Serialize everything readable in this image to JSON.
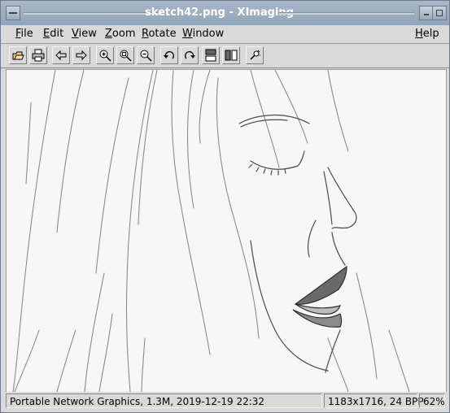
{
  "window": {
    "title": "sketch42.png - XImaging"
  },
  "menubar": {
    "items": [
      {
        "key": "file",
        "label_u": "F",
        "label_rest": "ile"
      },
      {
        "key": "edit",
        "label_u": "E",
        "label_rest": "dit"
      },
      {
        "key": "view",
        "label_u": "V",
        "label_rest": "iew"
      },
      {
        "key": "zoom",
        "label_u": "Z",
        "label_rest": "oom"
      },
      {
        "key": "rotate",
        "label_u": "R",
        "label_rest": "otate"
      },
      {
        "key": "window",
        "label_u": "W",
        "label_rest": "indow"
      }
    ],
    "help": {
      "label_u": "H",
      "label_rest": "elp"
    }
  },
  "toolbar": {
    "tools": [
      "open-icon",
      "print-icon",
      "previous-icon",
      "next-icon",
      "zoom-in-icon",
      "zoom-fit-icon",
      "zoom-out-icon",
      "rotate-left-icon",
      "rotate-right-icon",
      "flip-vertical-icon",
      "flip-horizontal-icon",
      "brightness-icon"
    ]
  },
  "image": {
    "description_alt": "pencil sketch of a woman's face in profile"
  },
  "status": {
    "file_info": "Portable Network Graphics, 1.3M, 2019-12-19 22:32",
    "dimensions": "1183x1716, 24 BPP",
    "zoom": "62%"
  }
}
